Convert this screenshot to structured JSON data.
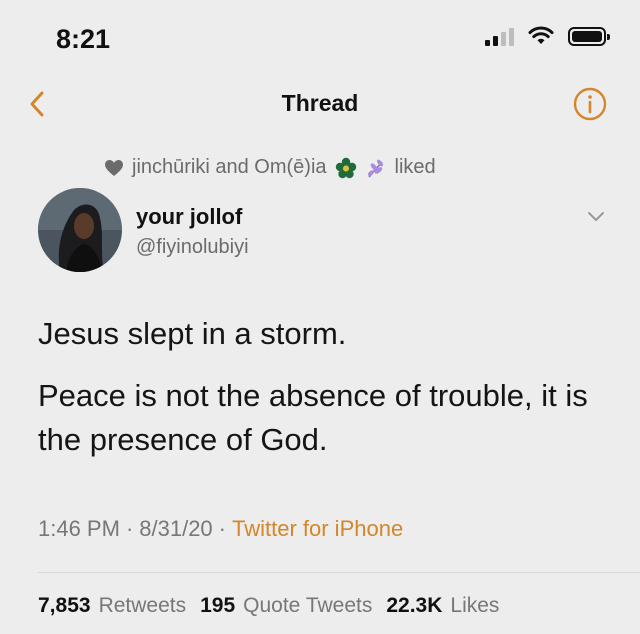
{
  "status_bar": {
    "time": "8:21"
  },
  "nav": {
    "title": "Thread",
    "back_icon": "chevron-left-icon",
    "info_icon": "info-circle-icon"
  },
  "social_context": {
    "text_before": "jinchūriki and Om(ē)ia",
    "text_after": "liked"
  },
  "tweet": {
    "display_name": "your jollof",
    "handle": "@fiyinolubiyi",
    "lines": [
      "Jesus slept in a storm.",
      "Peace is not the absence of trouble, it is the presence of God."
    ],
    "time": "1:46 PM",
    "date": "8/31/20",
    "source": "Twitter for iPhone",
    "separator": "·"
  },
  "stats": {
    "retweets_count": "7,853",
    "retweets_label": "Retweets",
    "quotes_count": "195",
    "quotes_label": "Quote Tweets",
    "likes_count": "22.3K",
    "likes_label": "Likes"
  },
  "colors": {
    "accent": "#d4862a",
    "text_primary": "#111111",
    "text_secondary": "#6b6b6b",
    "background": "#ededed"
  }
}
